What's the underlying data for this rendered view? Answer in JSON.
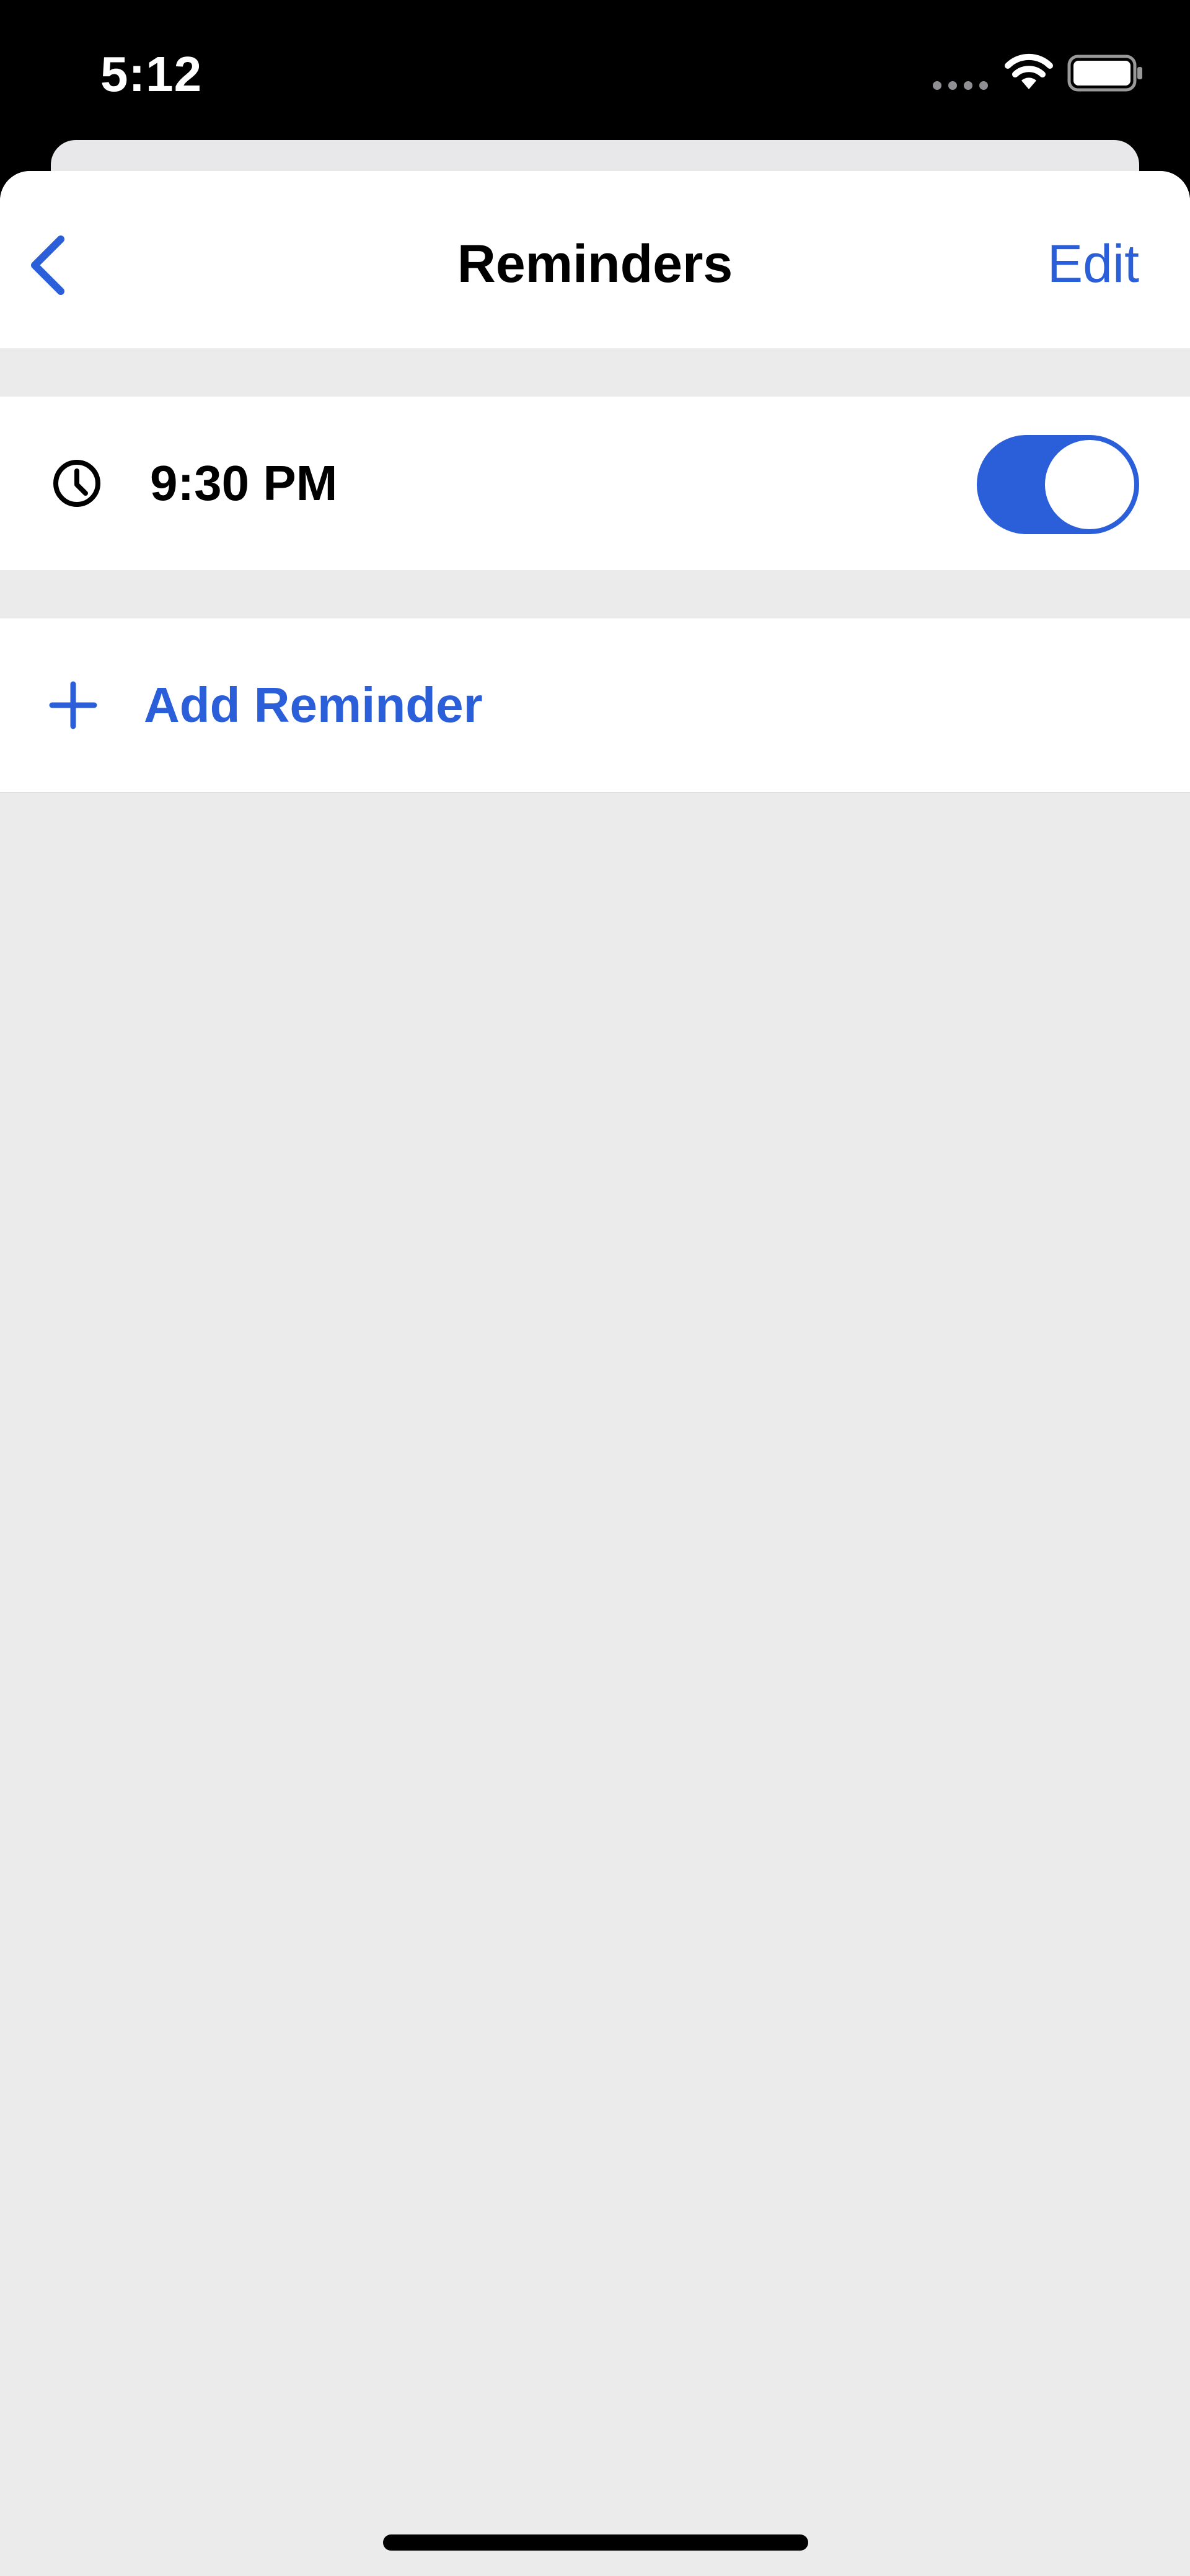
{
  "status_bar": {
    "time": "5:12"
  },
  "nav": {
    "title": "Reminders",
    "edit_label": "Edit"
  },
  "reminders": [
    {
      "time": "9:30 PM",
      "enabled": true
    }
  ],
  "add_reminder": {
    "label": "Add Reminder"
  },
  "colors": {
    "accent": "#2a5fd9",
    "background": "#ebebeb",
    "surface": "#ffffff"
  },
  "icons": [
    "chevron-left-icon",
    "clock-icon",
    "plus-icon",
    "wifi-icon",
    "battery-icon"
  ]
}
